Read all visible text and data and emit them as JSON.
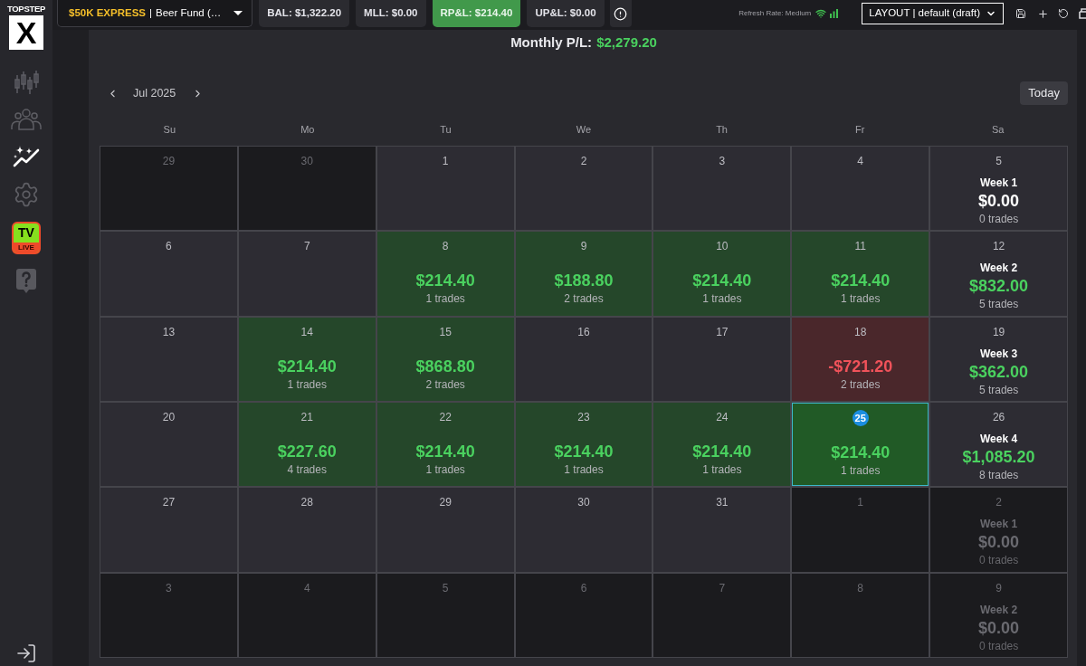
{
  "sidebar": {
    "logo": {
      "wordmark": "TOPSTEP",
      "mark": "X"
    },
    "items": [
      {
        "kind": "chart",
        "selected": false
      },
      {
        "kind": "team",
        "selected": false
      },
      {
        "kind": "insights",
        "selected": true
      },
      {
        "kind": "settings",
        "selected": false
      },
      {
        "kind": "tv",
        "selected": false,
        "title": "TV",
        "badge": "LIVE"
      },
      {
        "kind": "help",
        "selected": false
      }
    ]
  },
  "top_bar": {
    "account": {
      "plan": "$50K EXPRESS",
      "separator": "|",
      "name": "Beer Fund (…"
    },
    "stats": [
      {
        "label": "BAL: $1,322.20",
        "highlighted": false
      },
      {
        "label": "MLL: $0.00",
        "highlighted": false
      },
      {
        "label": "RP&L: $214.40",
        "highlighted": true
      },
      {
        "label": "UP&L: $0.00",
        "highlighted": false
      }
    ],
    "refresh_rate": "Refresh Rate: Medium",
    "layout": "LAYOUT | default (draft)"
  },
  "calendar": {
    "monthly_pl": {
      "label": "Monthly P/L:",
      "value": "$2,279.20"
    },
    "month": "Jul 2025",
    "today_button": "Today",
    "weekdays": [
      "Su",
      "Mo",
      "Tu",
      "We",
      "Th",
      "Fr",
      "Sa"
    ],
    "rows": [
      {
        "cells": [
          {
            "kind": "empty",
            "day": "29",
            "in_month": false,
            "today": false
          },
          {
            "kind": "empty",
            "day": "30",
            "in_month": false,
            "today": false
          },
          {
            "kind": "empty",
            "day": "1",
            "in_month": true,
            "today": false
          },
          {
            "kind": "empty",
            "day": "2",
            "in_month": true,
            "today": false
          },
          {
            "kind": "empty",
            "day": "3",
            "in_month": true,
            "today": false
          },
          {
            "kind": "empty",
            "day": "4",
            "in_month": true,
            "today": false
          },
          {
            "kind": "week",
            "day": "5",
            "in_month": true,
            "today": false,
            "label": "Week 1",
            "pnl": "$0.00",
            "trades": "0 trades",
            "profit": false
          }
        ]
      },
      {
        "cells": [
          {
            "kind": "empty",
            "day": "6",
            "in_month": true,
            "today": false
          },
          {
            "kind": "empty",
            "day": "7",
            "in_month": true,
            "today": false
          },
          {
            "kind": "profit",
            "day": "8",
            "in_month": true,
            "today": false,
            "pnl": "$214.40",
            "trades": "1 trades"
          },
          {
            "kind": "profit",
            "day": "9",
            "in_month": true,
            "today": false,
            "pnl": "$188.80",
            "trades": "2 trades"
          },
          {
            "kind": "profit",
            "day": "10",
            "in_month": true,
            "today": false,
            "pnl": "$214.40",
            "trades": "1 trades"
          },
          {
            "kind": "profit",
            "day": "11",
            "in_month": true,
            "today": false,
            "pnl": "$214.40",
            "trades": "1 trades"
          },
          {
            "kind": "week",
            "day": "12",
            "in_month": true,
            "today": false,
            "label": "Week 2",
            "pnl": "$832.00",
            "trades": "5 trades",
            "profit": true
          }
        ]
      },
      {
        "cells": [
          {
            "kind": "empty",
            "day": "13",
            "in_month": true,
            "today": false
          },
          {
            "kind": "profit",
            "day": "14",
            "in_month": true,
            "today": false,
            "pnl": "$214.40",
            "trades": "1 trades"
          },
          {
            "kind": "profit",
            "day": "15",
            "in_month": true,
            "today": false,
            "pnl": "$868.80",
            "trades": "2 trades"
          },
          {
            "kind": "empty",
            "day": "16",
            "in_month": true,
            "today": false
          },
          {
            "kind": "empty",
            "day": "17",
            "in_month": true,
            "today": false
          },
          {
            "kind": "loss",
            "day": "18",
            "in_month": true,
            "today": false,
            "pnl": "-$721.20",
            "trades": "2 trades"
          },
          {
            "kind": "week",
            "day": "19",
            "in_month": true,
            "today": false,
            "label": "Week 3",
            "pnl": "$362.00",
            "trades": "5 trades",
            "profit": true
          }
        ]
      },
      {
        "cells": [
          {
            "kind": "empty",
            "day": "20",
            "in_month": true,
            "today": false
          },
          {
            "kind": "profit",
            "day": "21",
            "in_month": true,
            "today": false,
            "pnl": "$227.60",
            "trades": "4 trades"
          },
          {
            "kind": "profit",
            "day": "22",
            "in_month": true,
            "today": false,
            "pnl": "$214.40",
            "trades": "1 trades"
          },
          {
            "kind": "profit",
            "day": "23",
            "in_month": true,
            "today": false,
            "pnl": "$214.40",
            "trades": "1 trades"
          },
          {
            "kind": "profit",
            "day": "24",
            "in_month": true,
            "today": false,
            "pnl": "$214.40",
            "trades": "1 trades"
          },
          {
            "kind": "profit",
            "day": "25",
            "in_month": true,
            "today": true,
            "pnl": "$214.40",
            "trades": "1 trades"
          },
          {
            "kind": "week",
            "day": "26",
            "in_month": true,
            "today": false,
            "label": "Week 4",
            "pnl": "$1,085.20",
            "trades": "8 trades",
            "profit": true
          }
        ]
      },
      {
        "cells": [
          {
            "kind": "empty",
            "day": "27",
            "in_month": true,
            "today": false
          },
          {
            "kind": "empty",
            "day": "28",
            "in_month": true,
            "today": false
          },
          {
            "kind": "empty",
            "day": "29",
            "in_month": true,
            "today": false
          },
          {
            "kind": "empty",
            "day": "30",
            "in_month": true,
            "today": false
          },
          {
            "kind": "empty",
            "day": "31",
            "in_month": true,
            "today": false
          },
          {
            "kind": "empty",
            "day": "1",
            "in_month": false,
            "today": false
          },
          {
            "kind": "week",
            "day": "2",
            "in_month": false,
            "today": false,
            "label": "Week 1",
            "pnl": "$0.00",
            "trades": "0 trades",
            "profit": false
          }
        ]
      },
      {
        "cells": [
          {
            "kind": "empty",
            "day": "3",
            "in_month": false,
            "today": false
          },
          {
            "kind": "empty",
            "day": "4",
            "in_month": false,
            "today": false
          },
          {
            "kind": "empty",
            "day": "5",
            "in_month": false,
            "today": false
          },
          {
            "kind": "empty",
            "day": "6",
            "in_month": false,
            "today": false
          },
          {
            "kind": "empty",
            "day": "7",
            "in_month": false,
            "today": false
          },
          {
            "kind": "empty",
            "day": "8",
            "in_month": false,
            "today": false
          },
          {
            "kind": "week",
            "day": "9",
            "in_month": false,
            "today": false,
            "label": "Week 2",
            "pnl": "$0.00",
            "trades": "0 trades",
            "profit": false
          }
        ]
      }
    ]
  }
}
